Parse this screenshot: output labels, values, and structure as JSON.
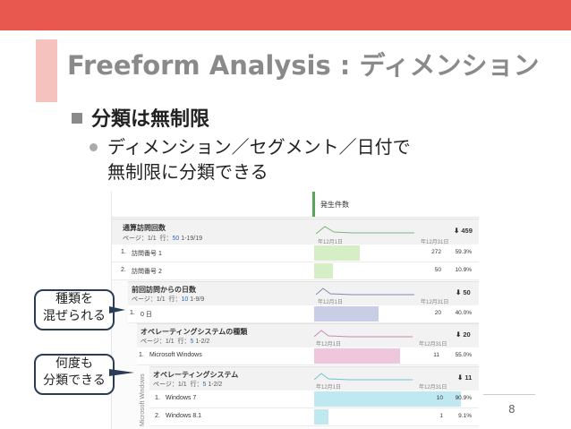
{
  "slide": {
    "title": "Freeform Analysis : ディメンション",
    "bullet1": "分類は無制限",
    "bullet2_line1": "ディメンション／セグメント／日付で",
    "bullet2_line2": "無制限に分類できる",
    "page_number": "8",
    "callout1_line1": "種類を",
    "callout1_line2": "混ぜられる",
    "callout2_line1": "何度も",
    "callout2_line2": "分類できる",
    "colors": {
      "topbar": "#e8584f",
      "accent": "#f6c2bd"
    }
  },
  "report": {
    "metric_header": "発生件数",
    "groups": [
      {
        "title": "通算訪問回数",
        "pager": "ページ：",
        "page": "1",
        "page_total": "/1",
        "rows_label": "行：",
        "rows_value": "50",
        "rows_range": "1-19/19",
        "date_start": "年12月1日",
        "date_end": "年12月31日",
        "trend": "459",
        "rows": [
          {
            "index": "1.",
            "label": "訪問番号 1",
            "value": "272",
            "pct": "59.3%",
            "fraction": 0.593
          },
          {
            "index": "2.",
            "label": "訪問番号 2",
            "value": "50",
            "pct": "10.9%",
            "fraction": 0.109
          }
        ]
      },
      {
        "title": "前回訪問からの日数",
        "pager": "ページ：",
        "page": "1",
        "page_total": "/1",
        "rows_label": "行：",
        "rows_value": "10",
        "rows_range": "1-9/9",
        "date_start": "年12月1日",
        "date_end": "年12月31日",
        "trend": "50",
        "rows": [
          {
            "index": "1.",
            "label": "0 日",
            "value": "20",
            "pct": "40.0%",
            "fraction": 0.4
          }
        ]
      },
      {
        "title": "オペレーティングシステムの種類",
        "pager": "ページ：",
        "page": "1",
        "page_total": "/1",
        "rows_label": "行：",
        "rows_value": "5",
        "rows_range": "1-2/2",
        "date_start": "年12月1日",
        "date_end": "年12月31日",
        "trend": "20",
        "rows": [
          {
            "index": "1.",
            "label": "Microsoft Windows",
            "value": "11",
            "pct": "55.0%",
            "fraction": 0.55
          }
        ]
      },
      {
        "title": "オペレーティングシステム",
        "pager": "ページ：",
        "page": "1",
        "page_total": "/1",
        "rows_label": "行：",
        "rows_value": "5",
        "rows_range": "1-2/2",
        "date_start": "年12月1日",
        "date_end": "年12月31日",
        "trend": "11",
        "vertical_label": "Microsoft Windows",
        "rows": [
          {
            "index": "1.",
            "label": "Windows 7",
            "value": "10",
            "pct": "90.9%",
            "fraction": 0.909
          },
          {
            "index": "2.",
            "label": "Windows 8.1",
            "value": "1",
            "pct": "9.1%",
            "fraction": 0.091
          }
        ]
      }
    ]
  }
}
